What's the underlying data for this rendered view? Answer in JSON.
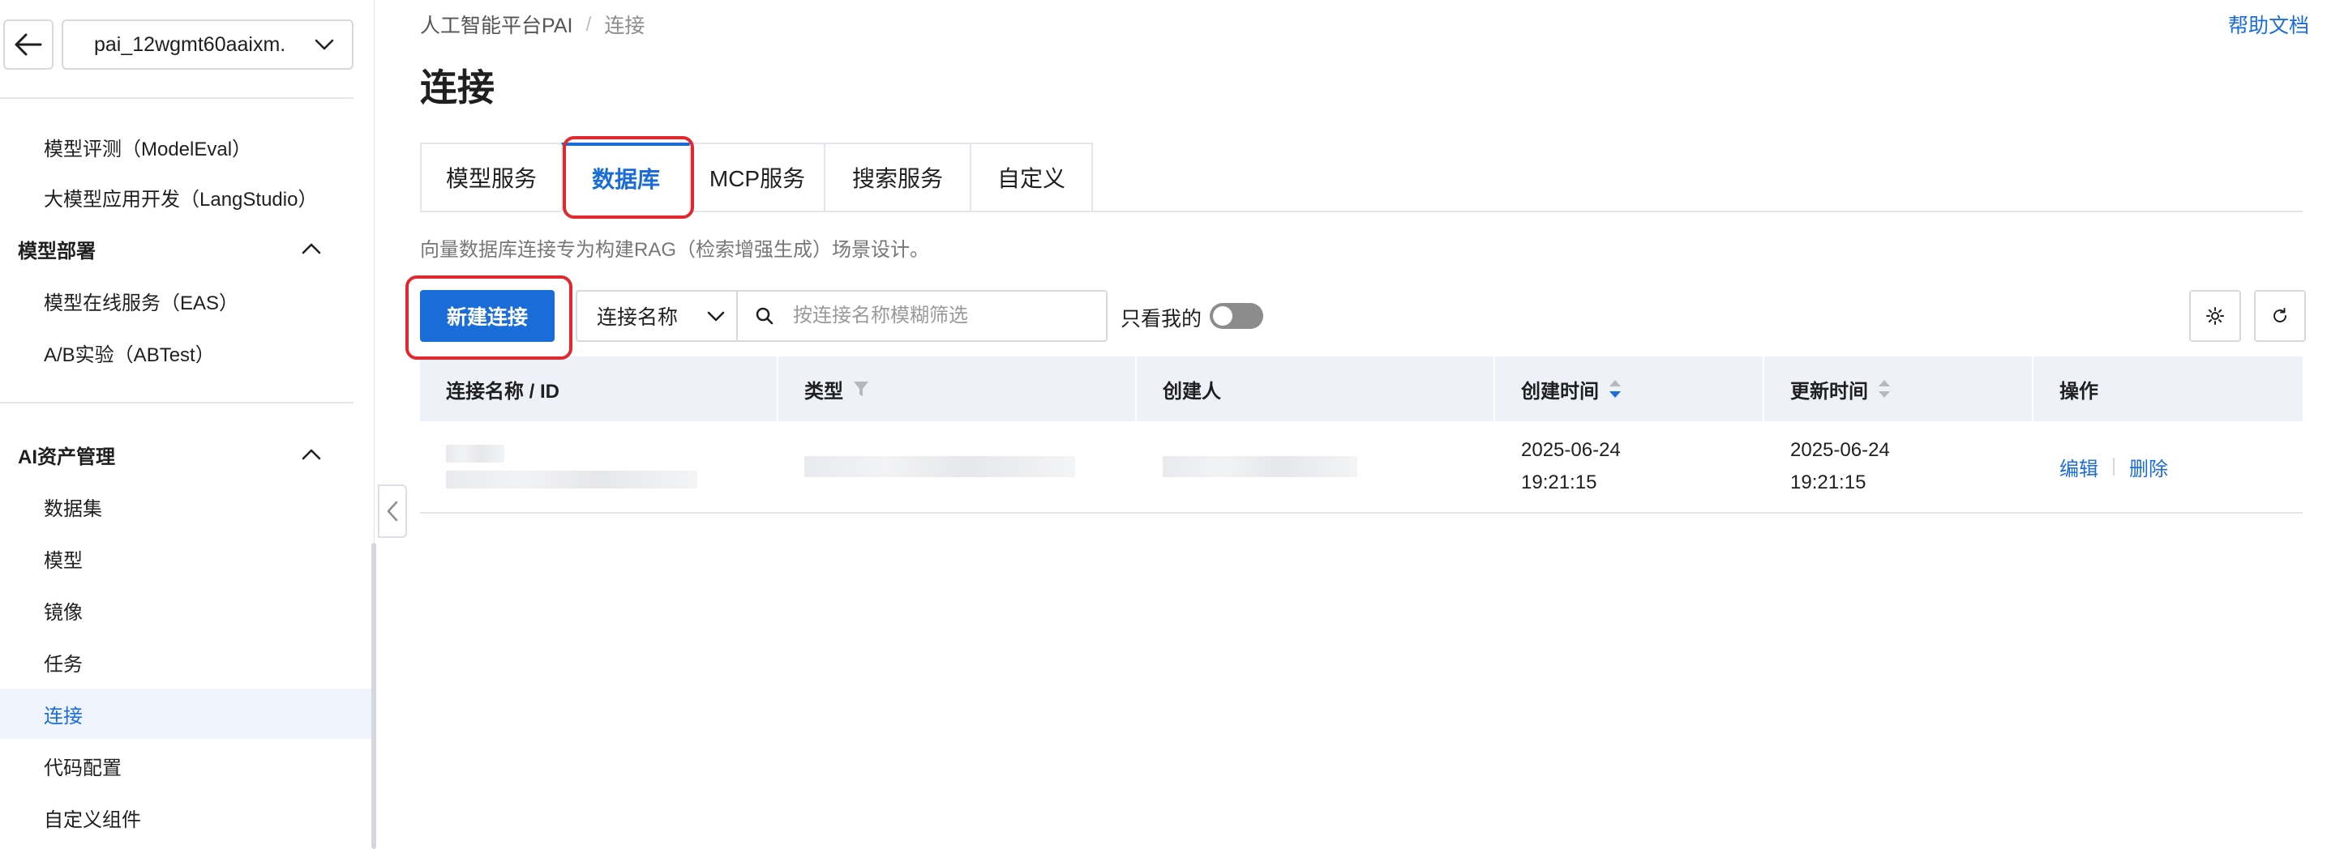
{
  "sidebar": {
    "workspace": "pai_12wgmt60aaixm.",
    "items_top": [
      {
        "label": "模型评测（ModelEval）"
      },
      {
        "label": "大模型应用开发（LangStudio）"
      }
    ],
    "group_deploy": {
      "label": "模型部署",
      "items": [
        {
          "label": "模型在线服务（EAS）"
        },
        {
          "label": "A/B实验（ABTest）"
        }
      ]
    },
    "group_assets": {
      "label": "AI资产管理",
      "items": [
        {
          "label": "数据集"
        },
        {
          "label": "模型"
        },
        {
          "label": "镜像"
        },
        {
          "label": "任务"
        },
        {
          "label": "连接",
          "active": true
        },
        {
          "label": "代码配置"
        },
        {
          "label": "自定义组件"
        }
      ]
    }
  },
  "header": {
    "breadcrumb": [
      "人工智能平台PAI",
      "连接"
    ],
    "help": "帮助文档",
    "title": "连接"
  },
  "tabs": [
    {
      "label": "模型服务"
    },
    {
      "label": "数据库",
      "active": true
    },
    {
      "label": "MCP服务"
    },
    {
      "label": "搜索服务"
    },
    {
      "label": "自定义"
    }
  ],
  "description": "向量数据库连接专为构建RAG（检索增强生成）场景设计。",
  "toolbar": {
    "new_button": "新建连接",
    "filter_field": "连接名称",
    "search_placeholder": "按连接名称模糊筛选",
    "mine_label": "只看我的"
  },
  "table": {
    "columns": [
      "连接名称 / ID",
      "类型",
      "创建人",
      "创建时间",
      "更新时间",
      "操作"
    ],
    "rows": [
      {
        "created_date": "2025-06-24",
        "created_time": "19:21:15",
        "updated_date": "2025-06-24",
        "updated_time": "19:21:15",
        "actions": [
          "编辑",
          "删除"
        ]
      }
    ]
  },
  "colors": {
    "accent": "#1a6dd8",
    "highlight": "#e0282e",
    "header_bg": "#eef2f8",
    "active_item_bg": "#eef3fc"
  }
}
